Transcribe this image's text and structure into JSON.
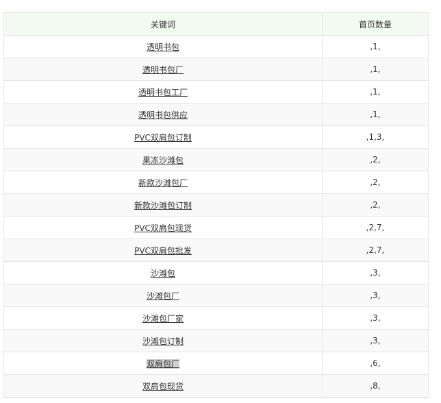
{
  "table": {
    "headers": {
      "keyword": "关键词",
      "count": "首页数量"
    },
    "rows": [
      {
        "keyword": "透明书包",
        "count": ",1,",
        "highlighted": false
      },
      {
        "keyword": "透明书包厂",
        "count": ",1,",
        "highlighted": false
      },
      {
        "keyword": "透明书包工厂",
        "count": ",1,",
        "highlighted": false
      },
      {
        "keyword": "透明书包供应",
        "count": ",1,",
        "highlighted": false
      },
      {
        "keyword": "PVC双肩包订制",
        "count": ",1,3,",
        "highlighted": false
      },
      {
        "keyword": "果冻沙滩包",
        "count": ",2,",
        "highlighted": false
      },
      {
        "keyword": "新款沙滩包厂",
        "count": ",2,",
        "highlighted": false
      },
      {
        "keyword": "新款沙滩包订制",
        "count": ",2,",
        "highlighted": false
      },
      {
        "keyword": "PVC双肩包现货",
        "count": ",2,7,",
        "highlighted": false
      },
      {
        "keyword": "PVC双肩包批发",
        "count": ",2,7,",
        "highlighted": false
      },
      {
        "keyword": "沙滩包",
        "count": ",3,",
        "highlighted": false
      },
      {
        "keyword": "沙滩包厂",
        "count": ",3,",
        "highlighted": false
      },
      {
        "keyword": "沙滩包厂家",
        "count": ",3,",
        "highlighted": false
      },
      {
        "keyword": "沙滩包订制",
        "count": ",3,",
        "highlighted": false
      },
      {
        "keyword": "双肩包厂",
        "count": ",6,",
        "highlighted": true
      },
      {
        "keyword": "双肩包现货",
        "count": ",8,",
        "highlighted": false
      }
    ]
  },
  "colors": {
    "header_bg": "#f1fbef",
    "border": "#e6e6e6",
    "stripe": "#f9f9f9",
    "highlight": "#d0d0d0"
  }
}
